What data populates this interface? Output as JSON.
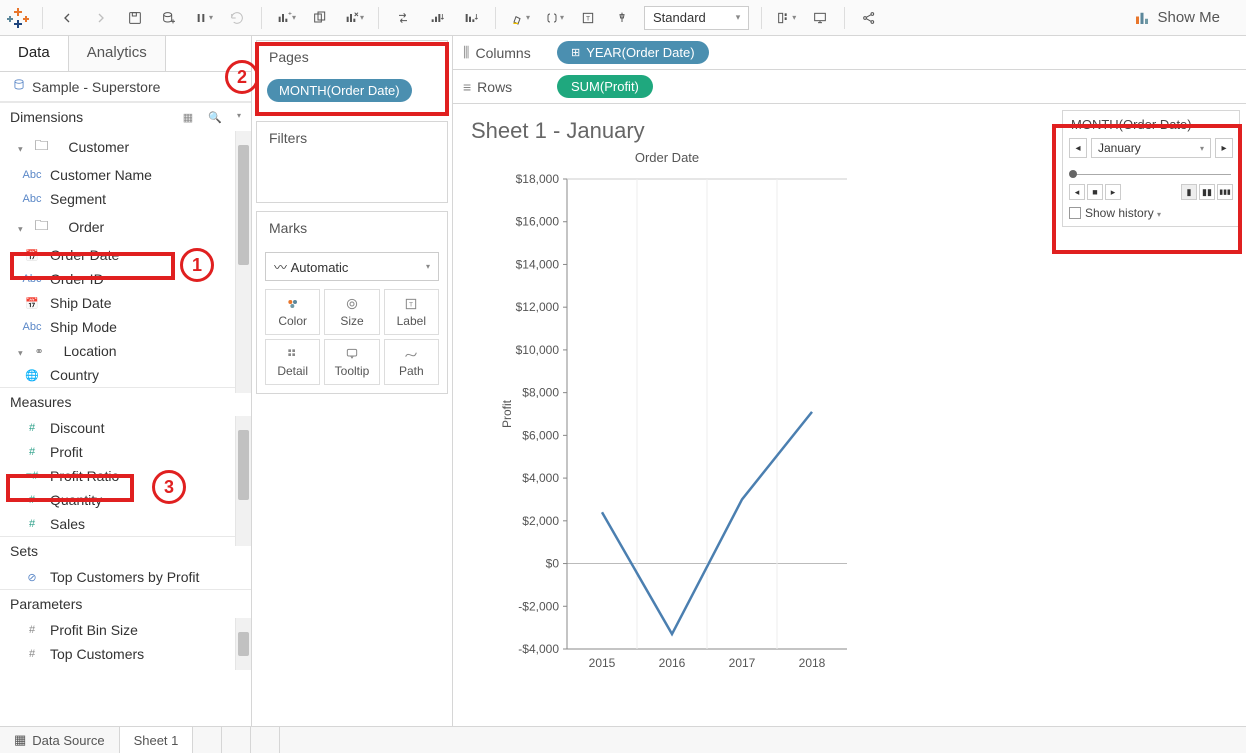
{
  "toolbar": {
    "format_dropdown": "Standard",
    "showme": "Show Me"
  },
  "data_pane": {
    "tab_data": "Data",
    "tab_analytics": "Analytics",
    "datasource": "Sample - Superstore",
    "dimensions_hdr": "Dimensions",
    "measures_hdr": "Measures",
    "sets_hdr": "Sets",
    "parameters_hdr": "Parameters",
    "dims": {
      "customer": "Customer",
      "customer_name": "Customer Name",
      "segment": "Segment",
      "order": "Order",
      "order_date": "Order Date",
      "order_id": "Order ID",
      "ship_date": "Ship Date",
      "ship_mode": "Ship Mode",
      "location": "Location",
      "country": "Country"
    },
    "meas": {
      "discount": "Discount",
      "profit": "Profit",
      "profit_ratio": "Profit Ratio",
      "quantity": "Quantity",
      "sales": "Sales"
    },
    "sets": {
      "top_customers": "Top Customers by Profit"
    },
    "params": {
      "profit_bin": "Profit Bin Size",
      "top_cust": "Top Customers"
    }
  },
  "shelves": {
    "pages": "Pages",
    "pages_pill": "MONTH(Order Date)",
    "filters": "Filters",
    "marks": "Marks",
    "mark_auto": "Automatic",
    "mark_color": "Color",
    "mark_size": "Size",
    "mark_label": "Label",
    "mark_detail": "Detail",
    "mark_tooltip": "Tooltip",
    "mark_path": "Path"
  },
  "cr": {
    "columns": "Columns",
    "rows": "Rows",
    "col_pill": "YEAR(Order Date)",
    "row_pill": "SUM(Profit)"
  },
  "sheet": {
    "title": "Sheet 1 - January",
    "axis_title": "Order Date",
    "y_label": "Profit"
  },
  "page_control": {
    "title": "MONTH(Order Date)",
    "current": "January",
    "show_history": "Show history"
  },
  "bottom": {
    "datasource": "Data Source",
    "sheet1": "Sheet 1"
  },
  "annotations": {
    "one": "1",
    "two": "2",
    "three": "3"
  },
  "chart_data": {
    "type": "line",
    "title": "Order Date",
    "xlabel": "",
    "ylabel": "Profit",
    "categories": [
      "2015",
      "2016",
      "2017",
      "2018"
    ],
    "values": [
      2400,
      -3300,
      3000,
      7100
    ],
    "ylim": [
      -4000,
      18000
    ],
    "yticks": [
      "$18,000",
      "$16,000",
      "$14,000",
      "$12,000",
      "$10,000",
      "$8,000",
      "$6,000",
      "$4,000",
      "$2,000",
      "$0",
      "-$2,000",
      "-$4,000"
    ]
  }
}
